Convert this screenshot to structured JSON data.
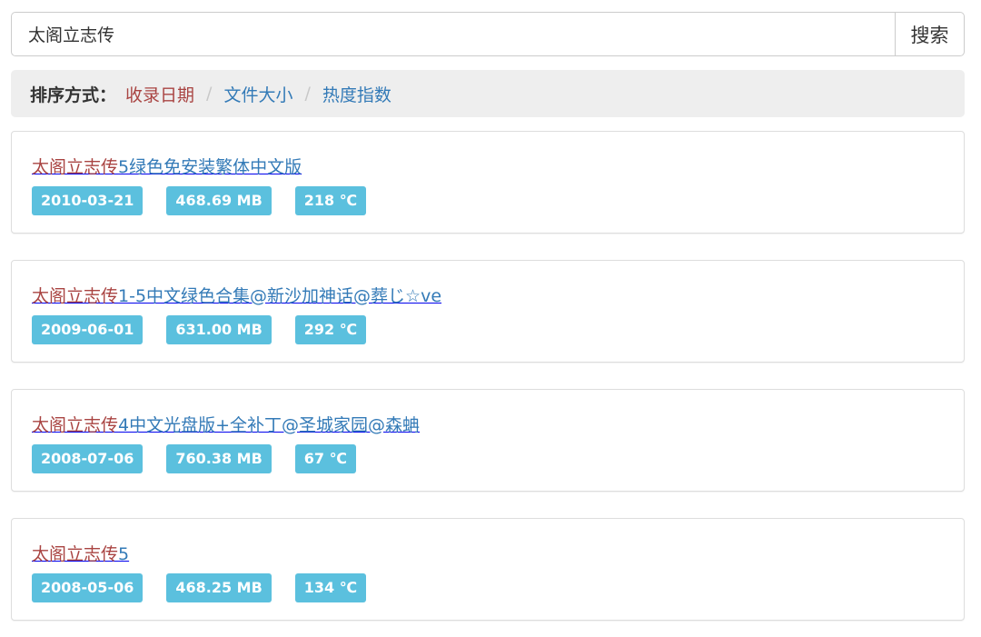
{
  "search": {
    "value": "太阁立志传",
    "button_label": "搜索"
  },
  "sort": {
    "label": "排序方式",
    "colon": "：",
    "options": [
      {
        "label": "收录日期",
        "active": true
      },
      {
        "label": "文件大小",
        "active": false
      },
      {
        "label": "热度指数",
        "active": false
      }
    ],
    "separator": "/"
  },
  "results": [
    {
      "title_highlight": "太阁立志传",
      "title_rest": "5绿色免安装繁体中文版",
      "date": "2010-03-21",
      "size": "468.69 MB",
      "heat": "218 ℃"
    },
    {
      "title_highlight": "太阁立志传",
      "title_rest": "1-5中文绿色合集@新沙加神话@葬じ☆ve",
      "date": "2009-06-01",
      "size": "631.00 MB",
      "heat": "292 ℃"
    },
    {
      "title_highlight": "太阁立志传",
      "title_rest": "4中文光盘版+全补丁@圣城家园@森蚺",
      "date": "2008-07-06",
      "size": "760.38 MB",
      "heat": "67 ℃"
    },
    {
      "title_highlight": "太阁立志传",
      "title_rest": "5",
      "date": "2008-05-06",
      "size": "468.25 MB",
      "heat": "134 ℃"
    }
  ],
  "colors": {
    "highlight": "#a94442",
    "link": "#337ab7",
    "tag_bg": "#5bc0de",
    "sortbar_bg": "#eeeeee"
  }
}
